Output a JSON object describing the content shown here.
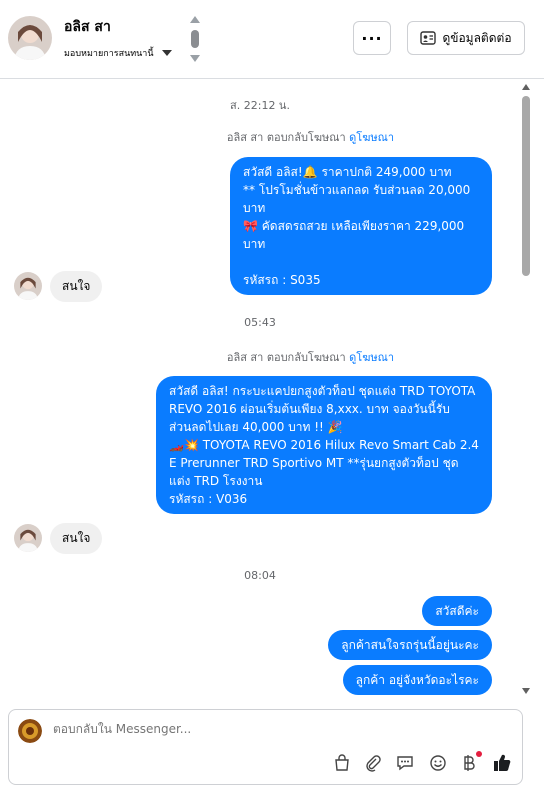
{
  "header": {
    "contact_name": "อลิส สา",
    "assign_label": "มอบหมายการสนทนานี้",
    "more_label": "···",
    "view_contact_label": "ดูข้อมูลติดต่อ"
  },
  "messages": {
    "t1": "ส. 22:12 น.",
    "reply1_prefix": "อลิส สา ตอบกลับโฆษณา",
    "reply1_link": "ดูโฆษณา",
    "ad1": "สวัสดี อลิส!🔔 ราคาปกติ 249,000 บาท\n** โปรโมชั่นข้าวแลกลด รับส่วนลด 20,000 บาท\n🎀 คัดสดรถสวย เหลือเพียงราคา 229,000 บาท\n\nรหัสรถ : S035",
    "in1": "สนใจ",
    "t2": "05:43",
    "reply2_prefix": "อลิส สา ตอบกลับโฆษณา",
    "reply2_link": "ดูโฆษณา",
    "ad2": "สวัสดี อลิส! กระบะแคปยกสูงตัวท็อป ชุดแต่ง TRD TOYOTA REVO 2016 ผ่อนเริ่มต้นเพียง 8,xxx. บาท จองวันนี้รับส่วนลดไปเลย 40,000 บาท !! 🎉\n🏎️💥 TOYOTA REVO 2016 Hilux Revo Smart Cab 2.4 E Prerunner TRD Sportivo MT **รุ่นยกสูงตัวท็อป ชุดแต่ง TRD โรงงาน\n รหัสรถ : V036",
    "in2": "สนใจ",
    "t3": "08:04",
    "out1": "สวัสดีค่ะ",
    "out2": "ลูกค้าสนใจรถรุ่นนี้อยู่นะคะ",
    "out3": "ลูกค้า อยู่จังหวัดอะไรคะ"
  },
  "composer": {
    "placeholder": "ตอบกลับใน Messenger...",
    "icons": [
      "shopping-bag-icon",
      "attachment-icon",
      "saved-reply-icon",
      "emoji-icon",
      "baht-payment-icon",
      "like-icon"
    ]
  },
  "colors": {
    "bubble_outgoing": "#0a7cff",
    "bubble_incoming": "#f0f0f0",
    "link": "#0a7cff",
    "notification_dot": "#e41e3f"
  }
}
